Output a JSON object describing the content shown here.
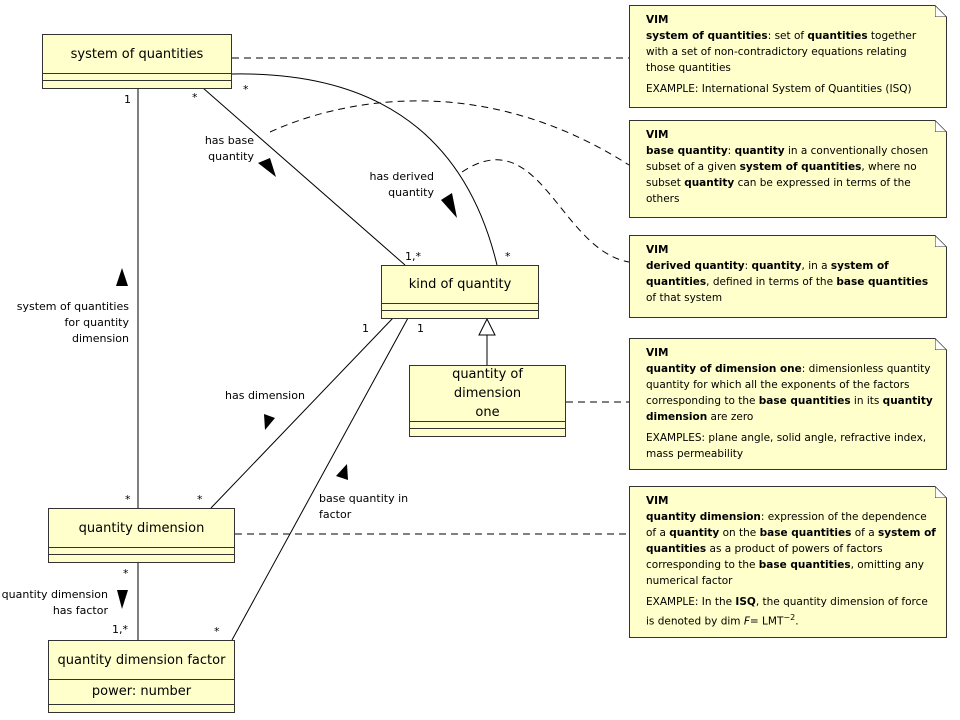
{
  "colors": {
    "class_fill": "#ffffcc",
    "note_fill": "#ffffcc",
    "line": "#000000"
  },
  "classes": {
    "system_of_quantities": "system of quantities",
    "kind_of_quantity": "kind of quantity",
    "quantity_of_dimension_one": "quantity of dimension one",
    "quantity_dimension": "quantity dimension",
    "quantity_dimension_factor": "quantity dimension factor",
    "quantity_dimension_factor_attr": "power: number"
  },
  "associations": {
    "has_base_quantity": "has base\nquantity",
    "has_derived_quantity": "has derived\nquantity",
    "soq_for_dimension": "system of quantities\nfor quantity\ndimension",
    "has_dimension": "has dimension",
    "base_quantity_in_factor": "base quantity in\nfactor",
    "dimension_has_factor": "quantity dimension\nhas factor"
  },
  "multiplicities": {
    "soq_dim_soq": "1",
    "soq_dim_qd": "*",
    "base_soq": "*",
    "base_koq": "1,*",
    "derived_soq": "*",
    "derived_koq": "*",
    "hasdim_koq": "1",
    "hasdim_qd": "*",
    "factor_koq": "1",
    "factor_qdf": "*",
    "qdf_qd": "*",
    "qdf_qdf": "1,*"
  },
  "notes": [
    {
      "title": "VIM",
      "body": [
        [
          {
            "t": "system of quantities",
            "b": true
          },
          {
            "t": ": set of "
          },
          {
            "t": "quantities",
            "b": true
          },
          {
            "t": " together with a set of non-contradictory equations relating those quantities"
          }
        ]
      ],
      "example": [
        {
          "t": "EXAMPLE: International System of Quantities (ISQ)"
        }
      ]
    },
    {
      "title": "VIM",
      "body": [
        [
          {
            "t": "base quantity",
            "b": true
          },
          {
            "t": ": "
          },
          {
            "t": "quantity",
            "b": true
          },
          {
            "t": " in a conventionally chosen subset of a given "
          },
          {
            "t": "system of quantities",
            "b": true
          },
          {
            "t": ", where no subset "
          },
          {
            "t": "quantity",
            "b": true
          },
          {
            "t": " can be expressed in terms of the others"
          }
        ]
      ]
    },
    {
      "title": "VIM",
      "body": [
        [
          {
            "t": "derived quantity",
            "b": true
          },
          {
            "t": ": "
          },
          {
            "t": "quantity",
            "b": true
          },
          {
            "t": ", in a "
          },
          {
            "t": "system of quantities",
            "b": true
          },
          {
            "t": ", defined in terms of the "
          },
          {
            "t": "base quantities",
            "b": true
          },
          {
            "t": " of that system"
          }
        ]
      ]
    },
    {
      "title": "VIM",
      "body": [
        [
          {
            "t": "quantity of dimension one",
            "b": true
          },
          {
            "t": ": dimensionless quantity quantity for which all the exponents of the factors corresponding to the "
          },
          {
            "t": "base quantities",
            "b": true
          },
          {
            "t": " in its "
          },
          {
            "t": "quantity dimension",
            "b": true
          },
          {
            "t": " are zero"
          }
        ]
      ],
      "example": [
        {
          "t": "EXAMPLES: plane angle, solid angle, refractive index, mass permeability"
        }
      ]
    },
    {
      "title": "VIM",
      "body": [
        [
          {
            "t": "quantity dimension",
            "b": true
          },
          {
            "t": ": expression of the dependence of a "
          },
          {
            "t": "quantity",
            "b": true
          },
          {
            "t": " on the "
          },
          {
            "t": "base quantities",
            "b": true
          },
          {
            "t": " of a "
          },
          {
            "t": "system of quantities",
            "b": true
          },
          {
            "t": " as a product of powers of factors corresponding to the "
          },
          {
            "t": "base quantities",
            "b": true
          },
          {
            "t": ", omitting any numerical factor"
          }
        ]
      ],
      "example": [
        {
          "t": "EXAMPLE: In the "
        },
        {
          "t": "ISQ",
          "b": true
        },
        {
          "t": ", the quantity dimension of force is denoted by dim "
        },
        {
          "t": "F",
          "i": true
        },
        {
          "t": "= LMT"
        },
        {
          "t": "−2",
          "sup": true
        },
        {
          "t": "."
        }
      ]
    }
  ]
}
